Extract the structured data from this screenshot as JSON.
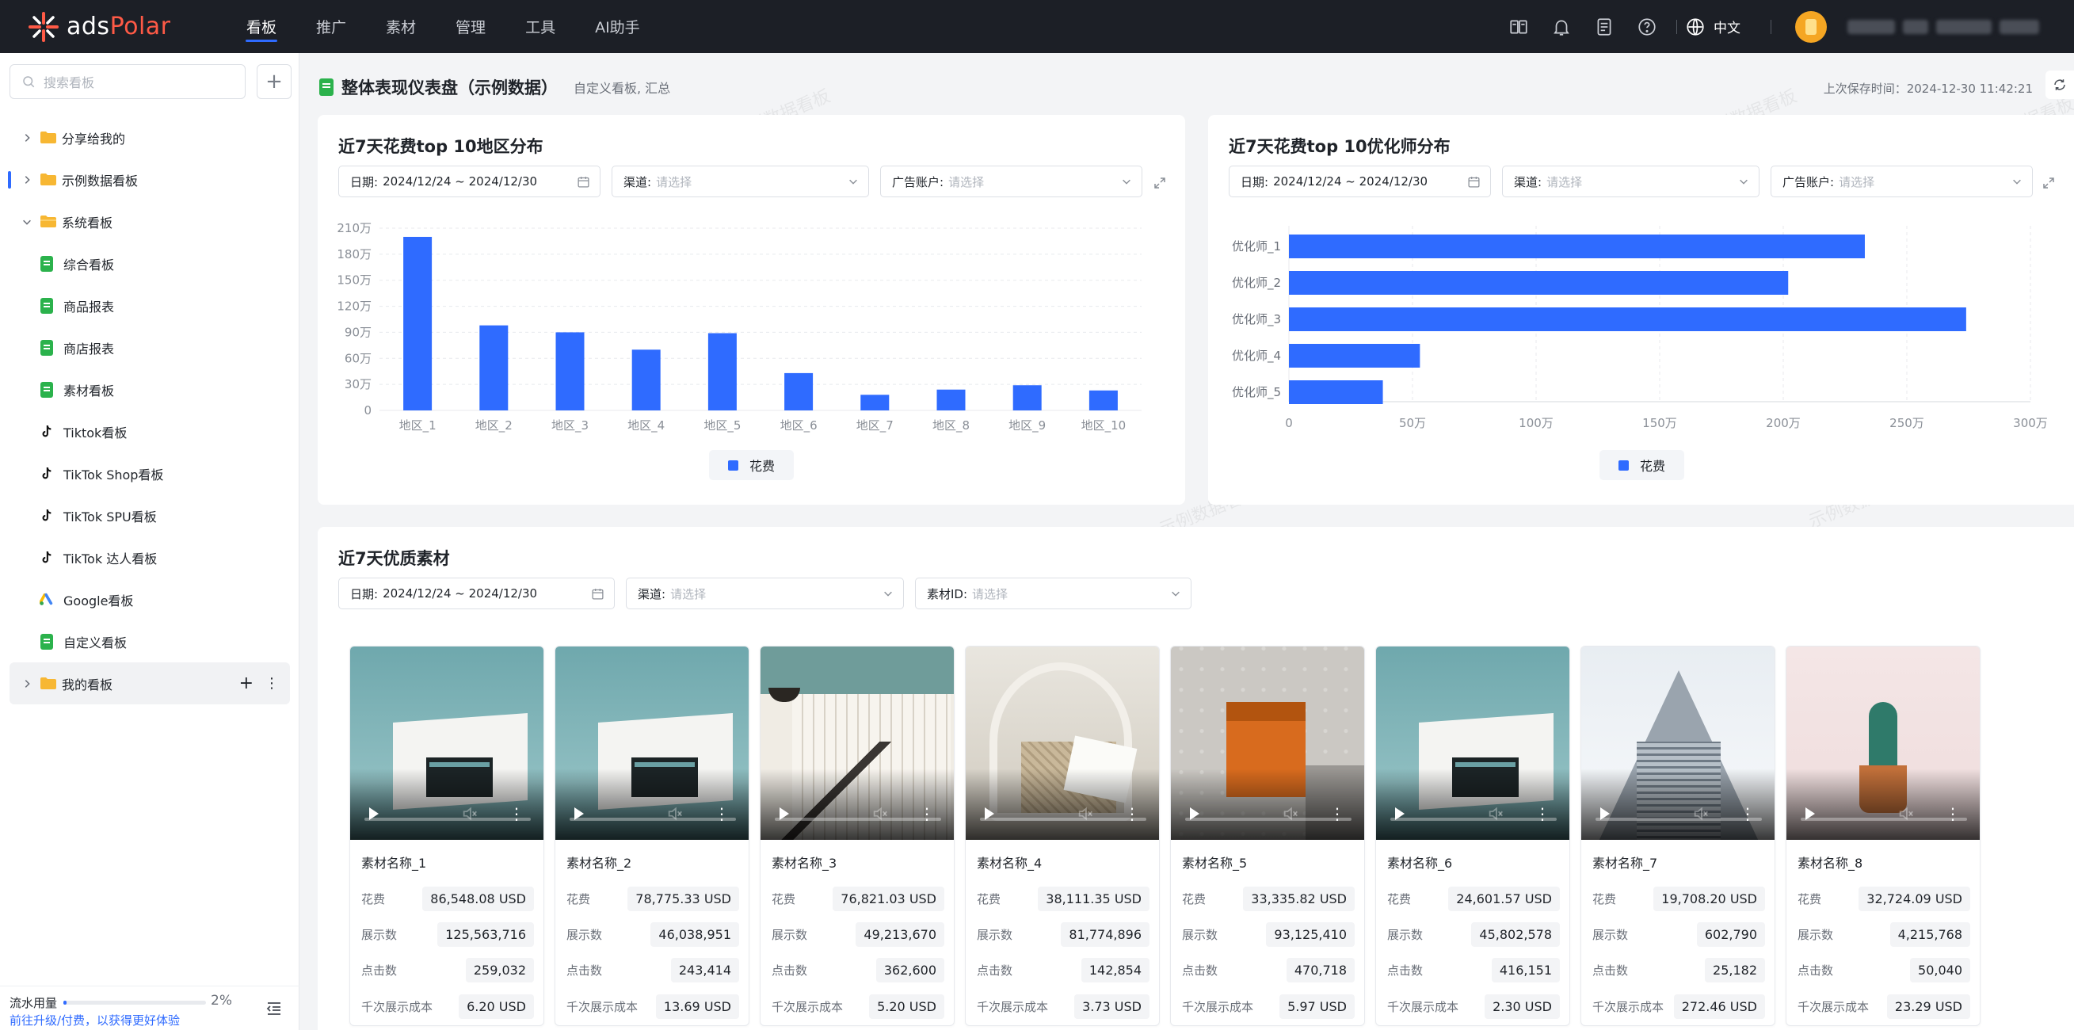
{
  "nav": {
    "logo_text_prefix": "ads",
    "logo_text_accent": "Polar",
    "items": [
      {
        "label": "看板",
        "active": true
      },
      {
        "label": "推广"
      },
      {
        "label": "素材"
      },
      {
        "label": "管理"
      },
      {
        "label": "工具"
      },
      {
        "label": "AI助手"
      }
    ],
    "lang": "中文",
    "icons": [
      "book-icon",
      "bell-icon",
      "document-icon",
      "help-icon",
      "globe-icon"
    ]
  },
  "sidebar": {
    "search_placeholder": "搜索看板",
    "add_symbol": "+",
    "items": [
      {
        "label": "分享给我的"
      },
      {
        "label": "示例数据看板"
      },
      {
        "label": "系统看板"
      },
      {
        "label": "综合看板"
      },
      {
        "label": "商品报表"
      },
      {
        "label": "商店报表"
      },
      {
        "label": "素材看板"
      },
      {
        "label": "Tiktok看板"
      },
      {
        "label": "TikTok Shop看板"
      },
      {
        "label": "TikTok SPU看板"
      },
      {
        "label": "TikTok 达人看板"
      },
      {
        "label": "Google看板"
      },
      {
        "label": "自定义看板"
      },
      {
        "label": "我的看板"
      }
    ],
    "quota_label": "流水用量",
    "quota_fraction": 0.02,
    "quota_pct": "2%",
    "upgrade_text": "前往升级/付费，以获得更好体验"
  },
  "header": {
    "title": "整体表现仪表盘（示例数据）",
    "subtitle": "自定义看板, 汇总",
    "save_time": "上次保存时间：2024-12-30 11:42:21"
  },
  "watermark_text": "示例数据看板",
  "region_card": {
    "title": "近7天花费top 10地区分布",
    "date_label": "日期:",
    "date_value": "2024/12/24 ~ 2024/12/30",
    "channel_label": "渠道:",
    "channel_placeholder": "请选择",
    "account_label": "广告账户:",
    "account_placeholder": "请选择",
    "legend": "花费"
  },
  "optimizer_card": {
    "title": "近7天花费top 10优化师分布",
    "date_label": "日期:",
    "date_value": "2024/12/24 ~ 2024/12/30",
    "channel_label": "渠道:",
    "channel_placeholder": "请选择",
    "account_label": "广告账户:",
    "account_placeholder": "请选择",
    "legend": "花费"
  },
  "materials_card": {
    "title": "近7天优质素材",
    "date_label": "日期:",
    "date_value": "2024/12/24 ~ 2024/12/30",
    "channel_label": "渠道:",
    "channel_placeholder": "请选择",
    "material_label": "素材ID:",
    "material_placeholder": "请选择",
    "row_labels": {
      "spend": "花费",
      "impressions": "展示数",
      "clicks": "点击数",
      "cpm": "千次展示成本"
    },
    "items": [
      {
        "name": "素材名称_1",
        "spend": "86,548.08 USD",
        "impressions": "125,563,716",
        "clicks": "259,032",
        "cpm": "6.20 USD",
        "theme": "building"
      },
      {
        "name": "素材名称_2",
        "spend": "78,775.33 USD",
        "impressions": "46,038,951",
        "clicks": "243,414",
        "cpm": "13.69 USD",
        "theme": "building"
      },
      {
        "name": "素材名称_3",
        "spend": "76,821.03 USD",
        "impressions": "49,213,670",
        "clicks": "362,600",
        "cpm": "5.20 USD",
        "theme": "stairs"
      },
      {
        "name": "素材名称_4",
        "spend": "38,111.35 USD",
        "impressions": "81,774,896",
        "clicks": "142,854",
        "cpm": "3.73 USD",
        "theme": "chair"
      },
      {
        "name": "素材名称_5",
        "spend": "33,335.82 USD",
        "impressions": "93,125,410",
        "clicks": "470,718",
        "cpm": "5.97 USD",
        "theme": "orange"
      },
      {
        "name": "素材名称_6",
        "spend": "24,601.57 USD",
        "impressions": "45,802,578",
        "clicks": "416,151",
        "cpm": "2.30 USD",
        "theme": "building"
      },
      {
        "name": "素材名称_7",
        "spend": "19,708.20 USD",
        "impressions": "602,790",
        "clicks": "25,182",
        "cpm": "272.46 USD",
        "theme": "tower"
      },
      {
        "name": "素材名称_8",
        "spend": "32,724.09 USD",
        "impressions": "4,215,768",
        "clicks": "50,040",
        "cpm": "23.29 USD",
        "theme": "cactus"
      }
    ]
  },
  "colors": {
    "accent": "#2f6bff",
    "bar": "#2f6bff",
    "green": "#2bb24c"
  },
  "chart_data": [
    {
      "type": "bar",
      "title": "近7天花费top 10地区分布",
      "categories": [
        "地区_1",
        "地区_2",
        "地区_3",
        "地区_4",
        "地区_5",
        "地区_6",
        "地区_7",
        "地区_8",
        "地区_9",
        "地区_10"
      ],
      "series": [
        {
          "name": "花费",
          "values": [
            2000000,
            980000,
            900000,
            700000,
            890000,
            430000,
            180000,
            240000,
            290000,
            230000
          ]
        }
      ],
      "yticks": [
        "0",
        "30万",
        "60万",
        "90万",
        "120万",
        "150万",
        "180万",
        "210万"
      ],
      "ylim": [
        0,
        2100000
      ],
      "grid": true,
      "legend": "bottom"
    },
    {
      "type": "bar",
      "orientation": "horizontal",
      "title": "近7天花费top 10优化师分布",
      "categories": [
        "优化师_1",
        "优化师_2",
        "优化师_3",
        "优化师_4",
        "优化师_5"
      ],
      "series": [
        {
          "name": "花费",
          "values": [
            2330000,
            2020000,
            2740000,
            530000,
            380000
          ]
        }
      ],
      "xticks": [
        "0",
        "50万",
        "100万",
        "150万",
        "200万",
        "250万",
        "300万"
      ],
      "xlim": [
        0,
        3000000
      ],
      "grid": true,
      "legend": "bottom"
    }
  ]
}
